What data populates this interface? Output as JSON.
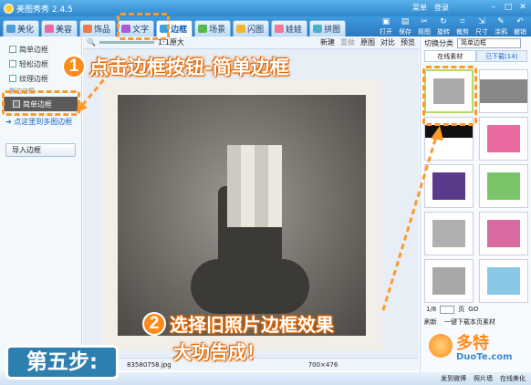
{
  "titlebar": {
    "title": "美图秀秀 2.4.5",
    "links": [
      "菜单",
      "登录"
    ]
  },
  "tabs": [
    {
      "label": "美化",
      "color": "#4f9bd8"
    },
    {
      "label": "美容",
      "color": "#e86aa0"
    },
    {
      "label": "饰品",
      "color": "#ef7a4a"
    },
    {
      "label": "文字",
      "color": "#ab5ad6"
    },
    {
      "label": "边框",
      "color": "#39a0e4"
    },
    {
      "label": "场景",
      "color": "#59b84b"
    },
    {
      "label": "闪图",
      "color": "#f2b72b"
    },
    {
      "label": "娃娃",
      "color": "#f07896"
    },
    {
      "label": "拼图",
      "color": "#4bb0c8"
    }
  ],
  "tools": [
    "打开",
    "保存",
    "抠图",
    "旋转",
    "裁剪",
    "尺寸",
    "涂鸦",
    "撤销"
  ],
  "left": {
    "categories": [
      "简单边框",
      "轻松边框",
      "纹理边框",
      "撕边边框",
      "简单边框"
    ],
    "link": "点这里到多图边框",
    "import_label": "导入边框"
  },
  "canvas_bar": {
    "zoom_label": "1:1原大",
    "actions": [
      "新建",
      "重做",
      "原图",
      "对比",
      "预览"
    ]
  },
  "status": {
    "filename": "83580758.jpg",
    "dims": "700×476"
  },
  "right": {
    "category_label": "切换分类",
    "category_value": "简单边框",
    "tabs": [
      "在线素材",
      "已下载(14)"
    ],
    "page_label": "1/8",
    "page_suffix": "页",
    "go_label": "GO",
    "refresh_label": "刷新",
    "download_all": "一键下载本页素材"
  },
  "bottom": {
    "items": [
      "发到微博",
      "照片墙",
      "在线美化"
    ]
  },
  "overlays": {
    "step1_number": "1",
    "step1_text": "点击边框按钮-简单边框",
    "step2_number": "2",
    "step2_line1": "选择旧照片边框效果",
    "step2_line2": "大功告成！",
    "step_label": "第五步:",
    "watermark_brand": "多特",
    "watermark_site": "DuoTe.com"
  },
  "thumbs": [
    {
      "kind": "plain"
    },
    {
      "kind": "dark-bars"
    },
    {
      "kind": "black-bar"
    },
    {
      "kind": "colored"
    },
    {
      "kind": "purple"
    },
    {
      "kind": "flowers"
    },
    {
      "kind": "plain"
    },
    {
      "kind": "colored"
    },
    {
      "kind": "plain"
    },
    {
      "kind": "colored"
    }
  ]
}
